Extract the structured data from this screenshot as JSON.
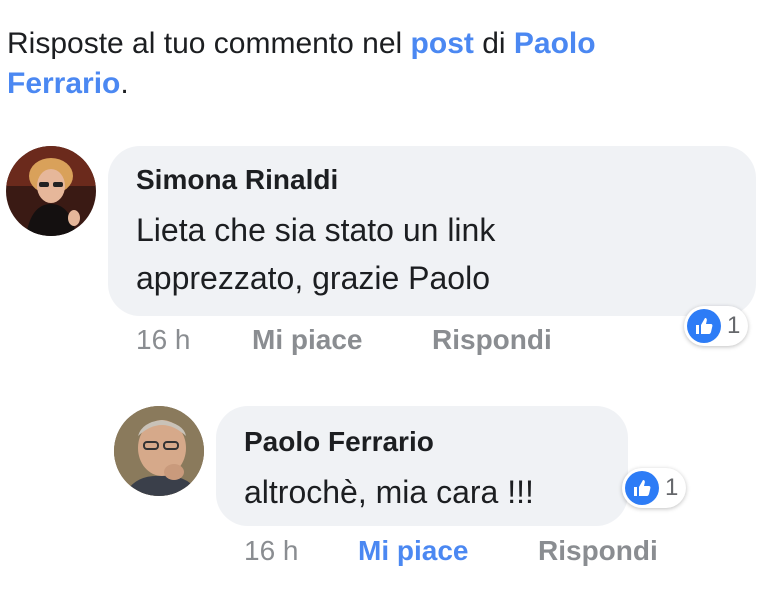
{
  "header": {
    "prefix": "Risposte al tuo commento nel ",
    "post_link": "post",
    "middle": " di ",
    "author_link": "Paolo Ferrario",
    "suffix": "."
  },
  "comments": [
    {
      "author": "Simona Rinaldi",
      "text": "Lieta che sia stato un link apprezzato, grazie Paolo",
      "time": "16 h",
      "like_label": "Mi piace",
      "reply_label": "Rispondi",
      "reaction_count": "1",
      "liked_by_viewer": false,
      "avatar_icon": "profile-photo"
    },
    {
      "author": "Paolo Ferrario",
      "text": "altrochè, mia cara !!!",
      "time": "16 h",
      "like_label": "Mi piace",
      "reply_label": "Rispondi",
      "reaction_count": "1",
      "liked_by_viewer": true,
      "avatar_icon": "profile-photo"
    }
  ],
  "colors": {
    "link": "#4b88f2",
    "bubble": "#f0f2f5",
    "muted": "#8a8d91",
    "like_badge": "#2d7cf6"
  }
}
